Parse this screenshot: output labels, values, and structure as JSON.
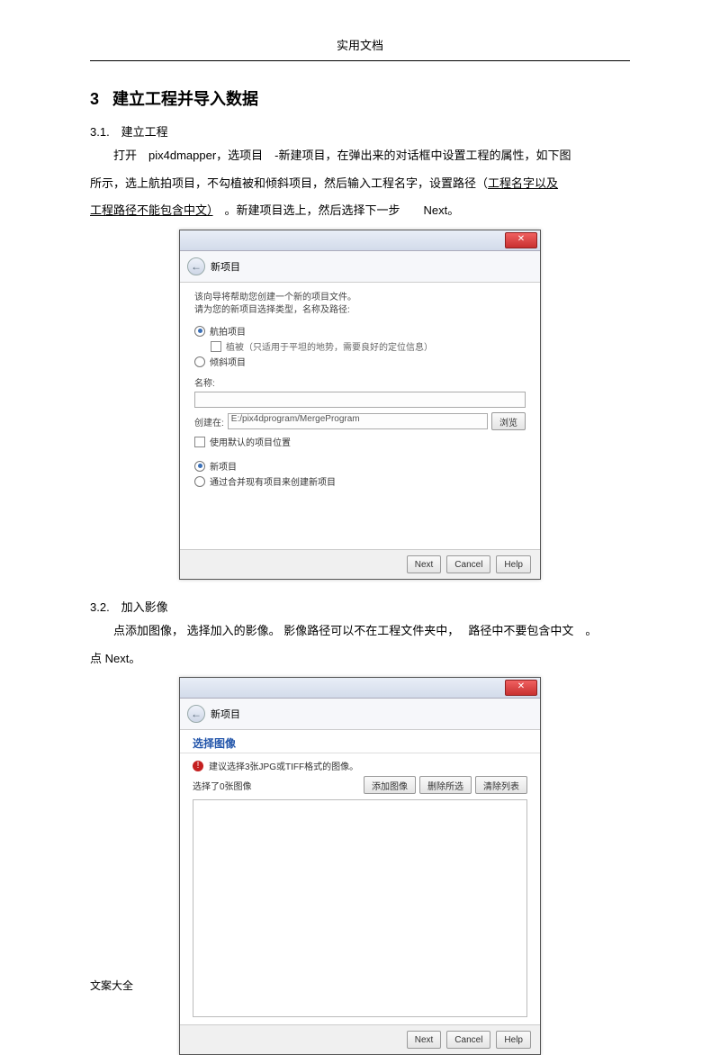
{
  "doc": {
    "header": "实用文档",
    "section_number": "3",
    "section_title": "建立工程并导入数据",
    "footer": "文案大全"
  },
  "s31": {
    "heading": "3.1.　建立工程",
    "p1a": "打开　pix4dmapper，选项目　-新建项目，在弹出来的对话框中设置工程的属性，如下图",
    "p1b": "所示，选上航拍项目，不勾植被和倾斜项目，然后输入工程名字，设置路径（",
    "p1b_u": "工程名字以及",
    "p1c_u": "工程路径不能包含中文）",
    "p1d": "　。新建项目选上，然后选择下一步　　Next。"
  },
  "dlg1": {
    "title": "新项目",
    "intro1": "该向导将帮助您创建一个新的项目文件。",
    "intro2": "请为您的新项目选择类型，名称及路径:",
    "r_air": "航拍项目",
    "c_veg": "植被（只适用于平坦的地势，需要良好的定位信息）",
    "r_tilt": "倾斜项目",
    "name_label": "名称:",
    "path_label": "创建在:",
    "path_value": "E:/pix4dprogram/MergeProgram",
    "browse": "浏览",
    "use_default": "使用默认的项目位置",
    "r_new": "新项目",
    "r_merge": "通过合并现有项目来创建新项目",
    "next": "Next",
    "cancel": "Cancel",
    "help": "Help"
  },
  "s32": {
    "heading": "3.2.　加入影像",
    "p1": "点添加图像，  选择加入的影像。  影像路径可以不在工程文件夹中，　 路径中不要包含中文　。",
    "p2": "点 Next。"
  },
  "dlg2": {
    "title": "新项目",
    "choose": "选择图像",
    "warn": "建议选择3张JPG或TIFF格式的图像。",
    "selected": "选择了0张图像",
    "add": "添加图像",
    "del": "删除所选",
    "clear": "清除列表",
    "next": "Next",
    "cancel": "Cancel",
    "help": "Help"
  }
}
